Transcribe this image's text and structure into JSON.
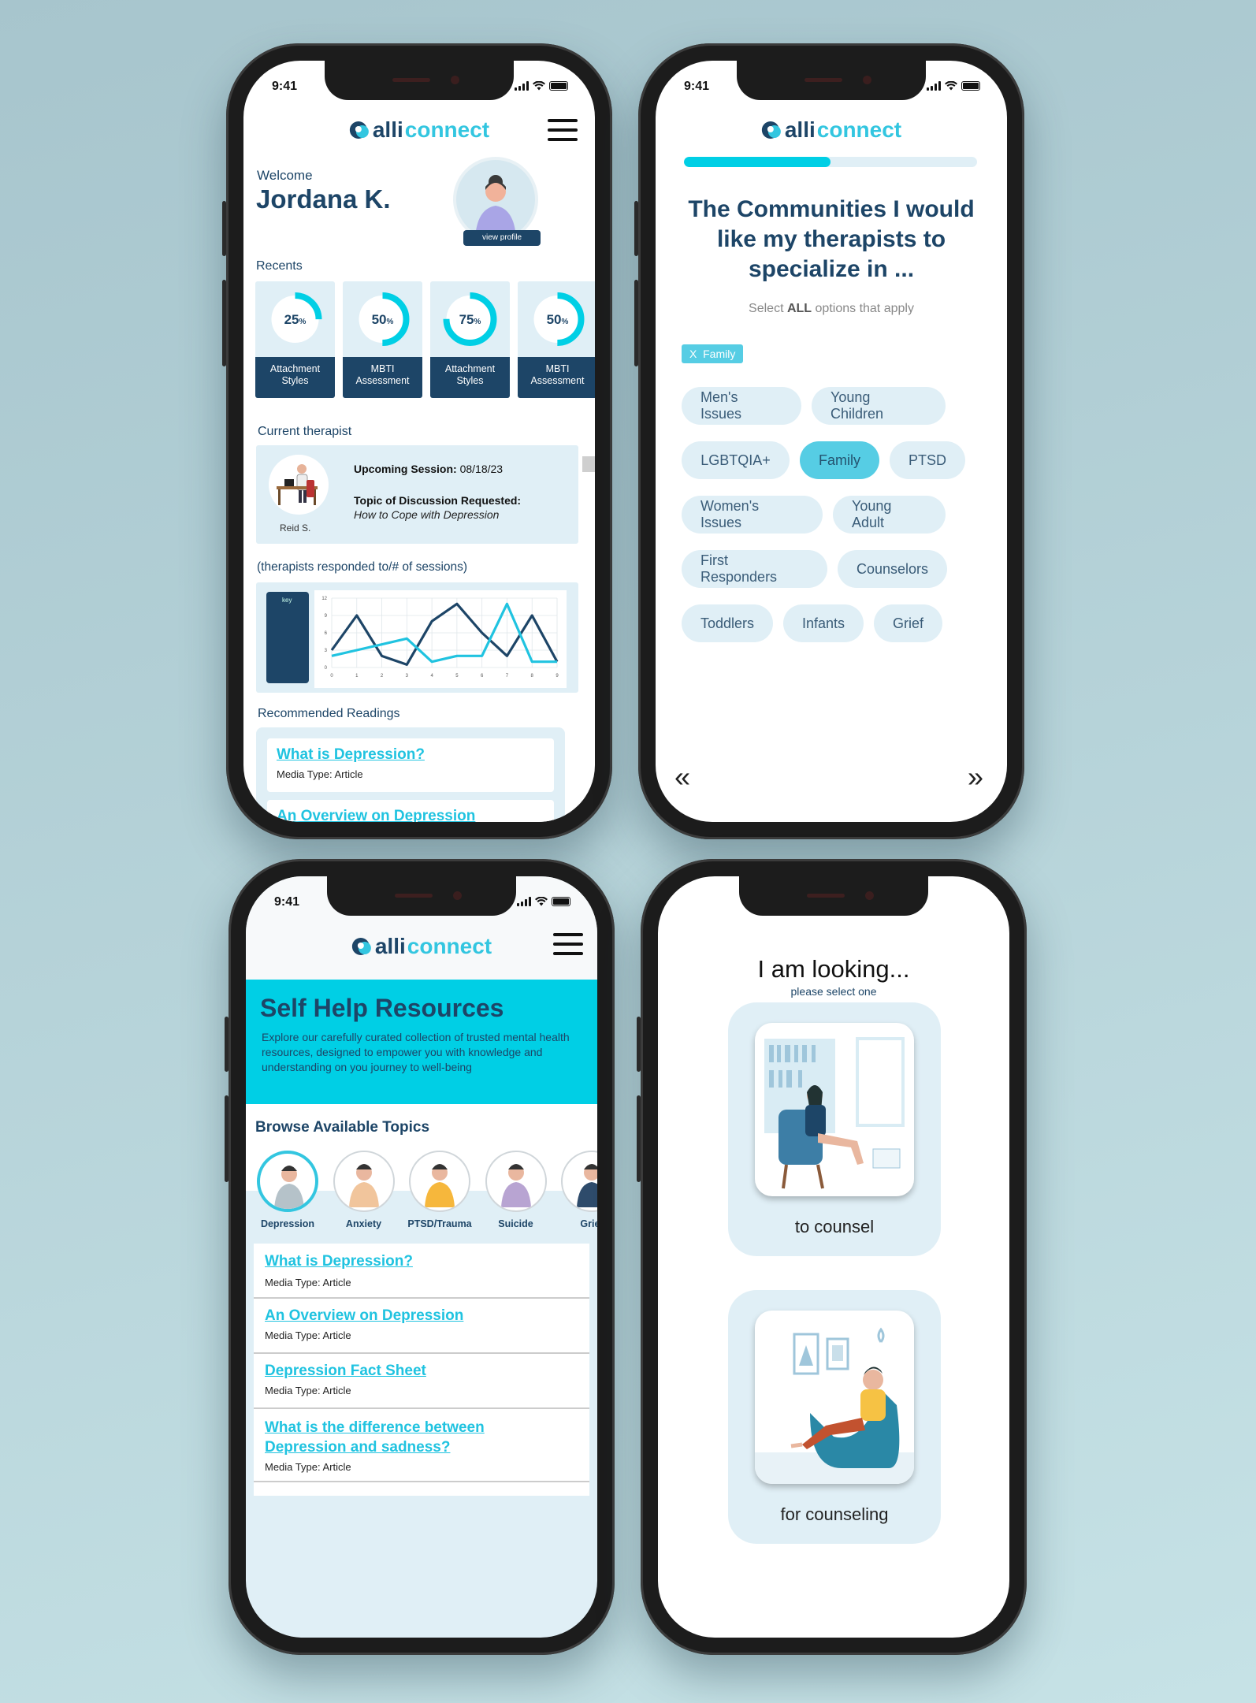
{
  "app": {
    "logo_part1": "alli",
    "logo_part2": "connect",
    "status_time": "9:41"
  },
  "colors": {
    "background": "#b6d3d9",
    "navy": "#1d4567",
    "cyan": "#20c3e0",
    "light_blue": "#e0eff6",
    "banner": "#00cfe5"
  },
  "dashboard": {
    "welcome": "Welcome",
    "user_name": "Jordana K.",
    "view_profile": "view profile",
    "recents_label": "Recents",
    "recents": [
      {
        "percent": 25,
        "pct_text": "25",
        "label_1": "Attachment",
        "label_2": "Styles"
      },
      {
        "percent": 50,
        "pct_text": "50",
        "label_1": "MBTI",
        "label_2": "Assessment"
      },
      {
        "percent": 75,
        "pct_text": "75",
        "label_1": "Attachment",
        "label_2": "Styles"
      },
      {
        "percent": 50,
        "pct_text": "50",
        "label_1": "MBTI",
        "label_2": "Assessment"
      }
    ],
    "pct_sign": "%",
    "therapist_label": "Current therapist",
    "therapist_name": "Reid S.",
    "session_label": "Upcoming Session:",
    "session_date": "08/18/23",
    "topic_label": "Topic of Discussion Requested:",
    "topic_value": "How to Cope with Depression",
    "chart_caption": "(therapists responded to/# of sessions)",
    "key_label": "key",
    "readings_label": "Recommended Readings",
    "readings": [
      {
        "title": "What is Depression?",
        "media": "Media Type: Article"
      },
      {
        "title": "An Overview on Depression",
        "media": ""
      }
    ]
  },
  "chart_data": {
    "type": "line",
    "x": [
      0,
      1,
      2,
      3,
      4,
      5,
      6,
      7,
      8,
      9
    ],
    "ylim": [
      0,
      12
    ],
    "yticks": [
      0,
      3,
      6,
      9,
      12
    ],
    "series": [
      {
        "color": "#1d4567",
        "values": [
          3,
          9,
          2,
          0.5,
          8,
          11,
          6,
          2,
          9,
          1
        ]
      },
      {
        "color": "#20c3e0",
        "values": [
          2,
          3,
          4,
          5,
          1,
          2,
          2,
          11,
          1,
          1
        ]
      }
    ],
    "grid": true
  },
  "communities": {
    "progress": 0.5,
    "title_1": "The Communities I would",
    "title_2": "like my therapists to",
    "title_3": "specialize in ...",
    "sub_before": "Select ",
    "sub_bold": "ALL",
    "sub_after": " options that apply",
    "chip_x": "X",
    "chip": "Family",
    "options": [
      "Men's Issues",
      "Young Children",
      "LGBTQIA+",
      "Family",
      "PTSD",
      "Women's Issues",
      "Young Adult",
      "First Responders",
      "Counselors",
      "Toddlers",
      "Infants",
      "Grief"
    ],
    "prev": "«",
    "next": "»"
  },
  "selfhelp": {
    "title": "Self Help Resources",
    "desc": "Explore our carefully curated collection of trusted mental health resources, designed to empower you with knowledge and understanding on you journey to well-being",
    "browse": "Browse Available Topics",
    "topics": [
      "Depression",
      "Anxiety",
      "PTSD/Trauma",
      "Suicide",
      "Grief"
    ],
    "articles": [
      {
        "title": "What is Depression?",
        "media": "Media Type: Article"
      },
      {
        "title": "An Overview on Depression",
        "media": "Media Type: Article"
      },
      {
        "title": "Depression Fact Sheet",
        "media": "Media Type: Article"
      },
      {
        "title_1": "What is the difference between",
        "title_2": "Depression and sadness?",
        "media": "Media Type: Article"
      }
    ]
  },
  "looking": {
    "title": "I am looking...",
    "subtitle": "please select one",
    "option_1": "to counsel",
    "option_2": "for counseling"
  }
}
